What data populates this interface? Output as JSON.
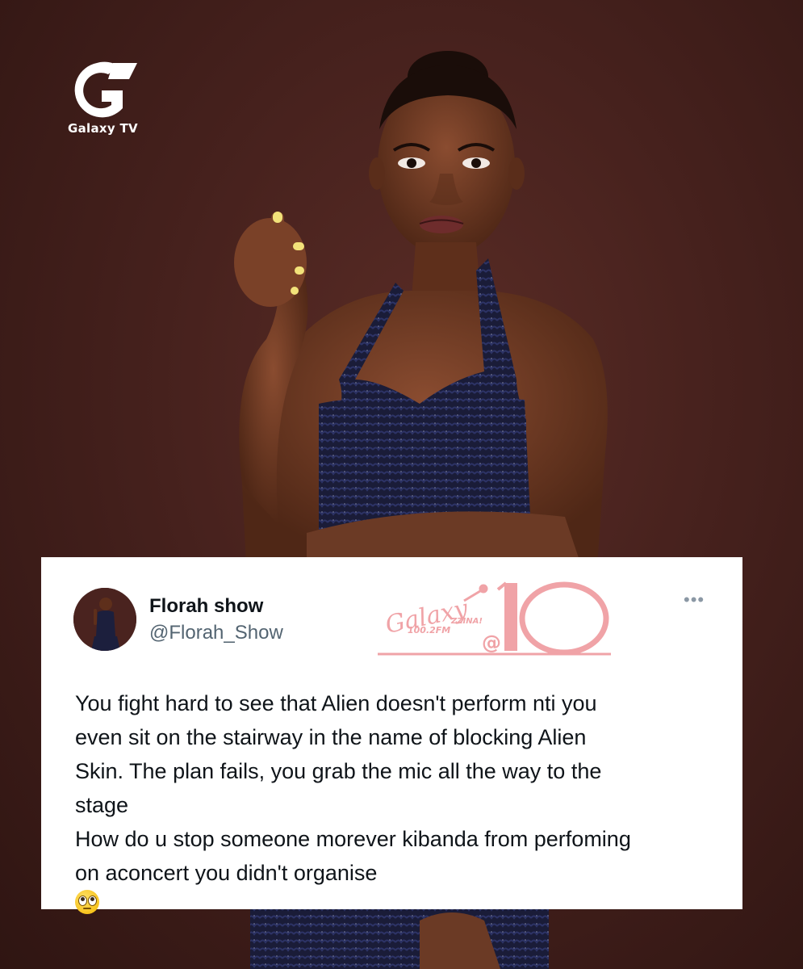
{
  "brand": {
    "logo_letter": "G",
    "name": "Galaxy TV"
  },
  "tweet": {
    "display_name": "Florah show",
    "handle": "@Florah_Show",
    "more_icon": "more-dots-icon",
    "lines": [
      "You fight hard to see that Alien doesn't perform nti you",
      "even sit on the stairway in the name of blocking Alien",
      "Skin. The plan fails, you grab the mic all the way to the",
      "stage",
      "How do u stop someone morever kibanda from perfoming",
      "on aconcert you didn't organise"
    ],
    "emoji": "face-with-rolling-eyes-icon"
  },
  "anniversary_logo": {
    "script_text": "Galaxy",
    "frequency": "100.2FM",
    "tagline": "ZZINA!",
    "at": "@",
    "number": "10",
    "color": "#f0a3a7"
  },
  "colors": {
    "background": "#46211d",
    "card": "#ffffff",
    "text": "#0f1419",
    "muted": "#536471",
    "dress": "#1c1f3d",
    "skin": "#6b3a25"
  }
}
